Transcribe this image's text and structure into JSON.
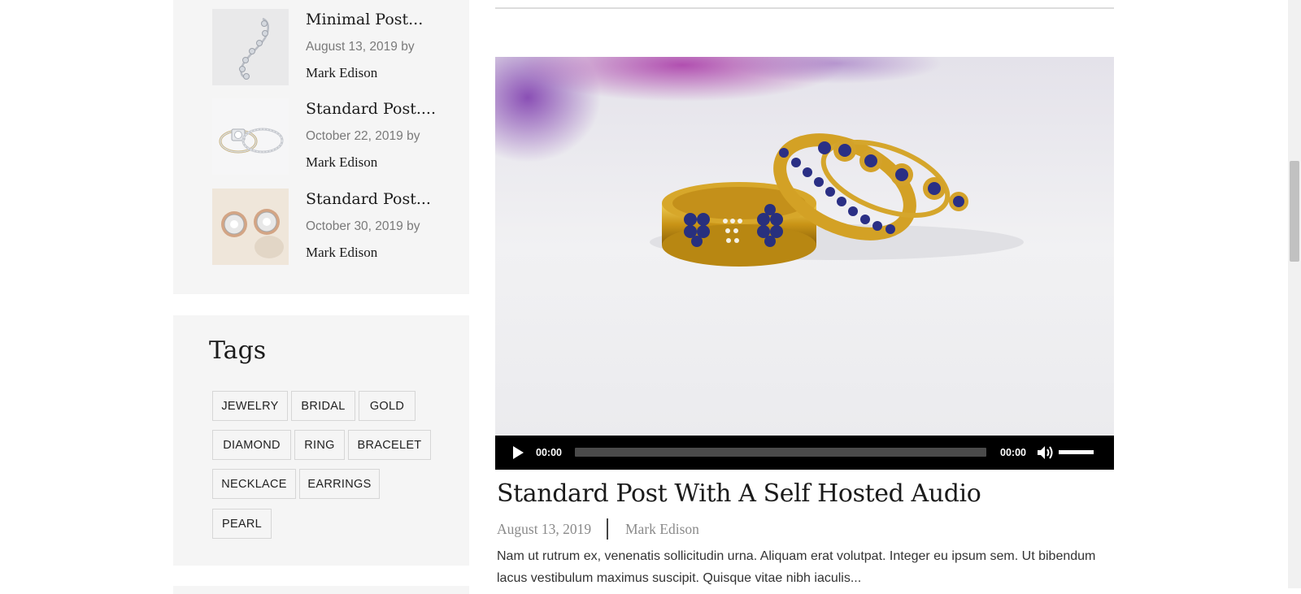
{
  "recent_posts": [
    {
      "title": "Minimal Post...",
      "date_by": "August 13, 2019 by",
      "author": "Mark Edison",
      "thumb": "bracelet"
    },
    {
      "title": "Standard Post....",
      "date_by": "October 22, 2019 by",
      "author": "Mark Edison",
      "thumb": "rings"
    },
    {
      "title": "Standard Post...",
      "date_by": "October 30, 2019 by",
      "author": "Mark Edison",
      "thumb": "earrings"
    }
  ],
  "tags": {
    "title": "Tags",
    "items": [
      "JEWELRY",
      "BRIDAL",
      "GOLD",
      "DIAMOND",
      "RING",
      "BRACELET",
      "NECKLACE",
      "EARRINGS",
      "PEARL"
    ]
  },
  "player": {
    "current_time": "00:00",
    "duration": "00:00",
    "progress": 0,
    "volume": 0.8
  },
  "article": {
    "title": "Standard Post With A Self Hosted Audio",
    "date": "August 13, 2019",
    "author": "Mark Edison",
    "excerpt_line1": "Nam ut rutrum ex, venenatis sollicitudin urna. Aliquam erat volutpat. Integer eu ipsum sem. Ut bibendum",
    "excerpt_line2": "lacus vestibulum maximus suscipit. Quisque vitae nibh iaculis..."
  },
  "colors": {
    "sidebar_bg": "#f5f5f5",
    "player_bg": "#000000",
    "muted_text": "#8a8a8a"
  },
  "icons": [
    "play-icon",
    "volume-icon"
  ]
}
